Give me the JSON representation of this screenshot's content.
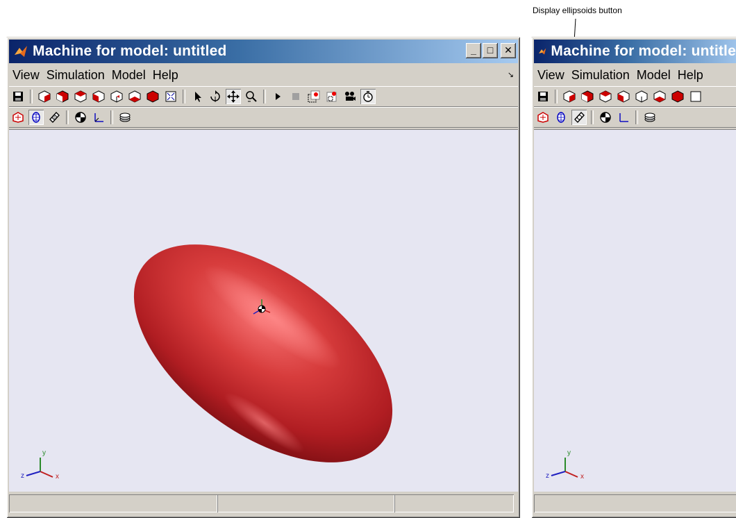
{
  "callout": {
    "text": "Display ellipsoids button"
  },
  "windows": [
    {
      "title": "Machine for model: untitled",
      "menu": [
        "View",
        "Simulation",
        "Model",
        "Help"
      ],
      "triad": {
        "x": "x",
        "y": "y",
        "z": "z"
      }
    },
    {
      "title": "Machine for model: untitled",
      "menu": [
        "View",
        "Simulation",
        "Model",
        "Help"
      ],
      "triad": {
        "x": "x",
        "y": "y",
        "z": "z"
      }
    }
  ],
  "icons": {
    "toolbar1": [
      "save-icon",
      "view-iso-icon",
      "view-front-icon",
      "view-top-icon",
      "view-side-icon",
      "view-back-icon",
      "view-bottom-icon",
      "view-right-icon",
      "fit-view-icon",
      "select-arrow-icon",
      "rotate-icon",
      "pan-icon",
      "zoom-icon",
      "play-icon",
      "stop-icon",
      "record-frame-icon",
      "record-region-icon",
      "camera-icon",
      "timer-icon"
    ],
    "toolbar2": [
      "display-cg-icon",
      "display-ellipsoids-icon",
      "display-convex-hulls-icon",
      "display-machine-icon",
      "display-axes-icon",
      "display-graphics-icon"
    ]
  },
  "colors": {
    "titlebar_start": "#0a246a",
    "titlebar_end": "#a6caf0",
    "viewport_bg": "#e6e6f2",
    "ellipsoid": "#c0282d"
  }
}
